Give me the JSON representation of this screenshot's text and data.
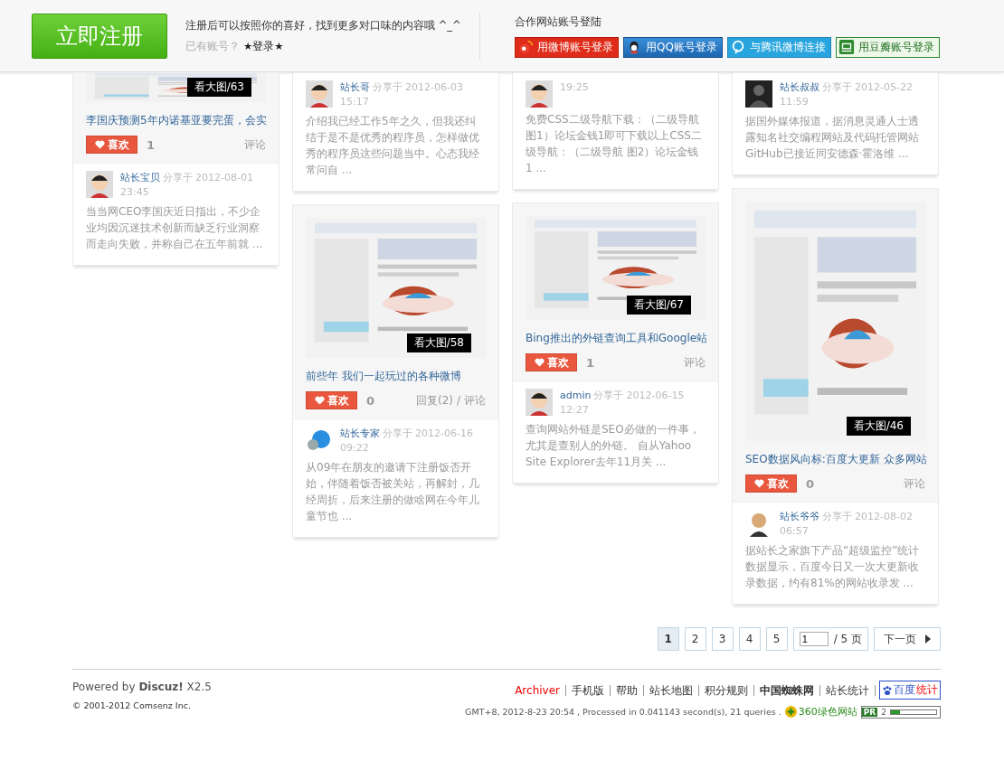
{
  "header": {
    "register": "立即注册",
    "intro": "注册后可以按照你的喜好，找到更多对口味的内容哦 ^_^",
    "has_account": "已有账号？",
    "login": "★登录★",
    "partner_title": "合作网站账号登陆",
    "partners": [
      {
        "label": "用微博账号登录",
        "kind": "weibo"
      },
      {
        "label": "用QQ账号登录",
        "kind": "qq"
      },
      {
        "label": "与腾讯微博连接",
        "kind": "tqq"
      },
      {
        "label": "用豆瓣账号登录",
        "kind": "douban"
      }
    ]
  },
  "columns": [
    {
      "cards": [
        {
          "image": {
            "kind": "picture",
            "badge": "看大图/63"
          },
          "title": "李国庆预测5年内诺基亚要完蛋，会实",
          "like": "喜欢",
          "like_count": "1",
          "comment_link": "评论",
          "comment": {
            "author": "站长宝贝",
            "shared": "分享于",
            "date": "2012-08-01",
            "time": "23:45",
            "avatar": {
              "kind": "boy"
            },
            "text": "当当网CEO李国庆近日指出，不少企业均因沉迷技术创新而缺乏行业洞察而走向失败，并称自己在五年前就 ..."
          }
        }
      ]
    },
    {
      "cards": [
        {
          "comment": {
            "author": "站长哥",
            "shared": "分享于",
            "date": "2012-06-03",
            "time": "15:17",
            "avatar": {
              "kind": "boy"
            },
            "text": "介绍我已经工作5年之久，但我还纠结于是不是优秀的程序员，怎样做优秀的程序员这些问题当中。心态我经常问自 ..."
          }
        },
        {
          "image": {
            "kind": "picture",
            "badge": "看大图/58"
          },
          "title": "前些年 我们一起玩过的各种微博",
          "like": "喜欢",
          "like_count": "0",
          "reply": "回复(2)",
          "sep": "/",
          "comment_link": "评论",
          "comment": {
            "author": "站长专家",
            "shared": "分享于",
            "date": "2012-06-16",
            "time": "09:22",
            "avatar": {
              "kind": "globe"
            },
            "text": "从09年在朋友的邀请下注册饭否开始，伴随着饭否被关站，再解封，几经周折，后来注册的做啥网在今年儿童节也 ..."
          }
        }
      ]
    },
    {
      "cards": [
        {
          "comment": {
            "time": "19:25",
            "avatar": {
              "kind": "boy"
            },
            "text": "免费CSS二级导航下载：（二级导航图1）论坛金钱1即可下载以上CSS二级导航：（二级导航 图2）论坛金钱1 ..."
          }
        },
        {
          "image": {
            "kind": "picture",
            "badge": "看大图/67"
          },
          "title": "Bing推出的外链查询工具和Google站",
          "like": "喜欢",
          "like_count": "1",
          "comment_link": "评论",
          "comment": {
            "author": "admin",
            "shared": "分享于",
            "date": "2012-06-15",
            "time": "12:27",
            "avatar": {
              "kind": "boy"
            },
            "text": "查询网站外链是SEO必做的一件事，尤其是查别人的外链。 自从Yahoo Site Explorer去年11月关 ..."
          }
        }
      ]
    },
    {
      "cards": [
        {
          "comment": {
            "author": "站长叔叔",
            "shared": "分享于",
            "date": "2012-05-22",
            "time": "11:59",
            "avatar": {
              "kind": "dark"
            },
            "text": "据国外媒体报道，据消息灵通人士透露知名社交编程网站及代码托管网站GitHub已接近同安德森·霍洛维 ..."
          }
        },
        {
          "image": {
            "kind": "picture",
            "badge": "看大图/46"
          },
          "title": "SEO数据风向标:百度大更新 众多网站",
          "like": "喜欢",
          "like_count": "0",
          "comment_link": "评论",
          "comment": {
            "author": "站长爷爷",
            "shared": "分享于",
            "date": "2012-08-02",
            "time": "06:57",
            "avatar": {
              "kind": "man"
            },
            "text": "据站长之家旗下产品“超级监控”统计数据显示，百度今日又一次大更新收录数据，约有81%的网站收录发 ..."
          }
        }
      ]
    }
  ],
  "pagination": {
    "pages": [
      {
        "label": "1",
        "selected": true
      },
      {
        "label": "2",
        "selected": false
      },
      {
        "label": "3",
        "selected": false
      },
      {
        "label": "4",
        "selected": false
      },
      {
        "label": "5",
        "selected": false
      }
    ],
    "page_input": "1",
    "total": "/ 5 页",
    "next": "下一页"
  },
  "footer": {
    "powered": "Powered by **Discuz!** X2.5",
    "copyright": "© 2001-2012 Comsenz Inc.",
    "links": [
      {
        "label": "Archiver",
        "kind": "highlight"
      },
      {
        "label": "手机版",
        "kind": "normal"
      },
      {
        "label": "帮助",
        "kind": "normal"
      },
      {
        "label": "站长地图",
        "kind": "normal"
      },
      {
        "label": "积分规则",
        "kind": "normal"
      },
      {
        "label": "中国蜘蛛网",
        "kind": "bold"
      },
      {
        "label": "站长统计",
        "kind": "normal"
      }
    ],
    "baidu": {
      "part1": "百度",
      "part2": "统计"
    },
    "stats": "GMT+8, 2012-8-23 20:54 , Processed in 0.041143 second(s), 21 queries .",
    "green_site": "360绿色网站",
    "pr": {
      "label": "PR",
      "value": "2",
      "level": 0.2
    }
  }
}
